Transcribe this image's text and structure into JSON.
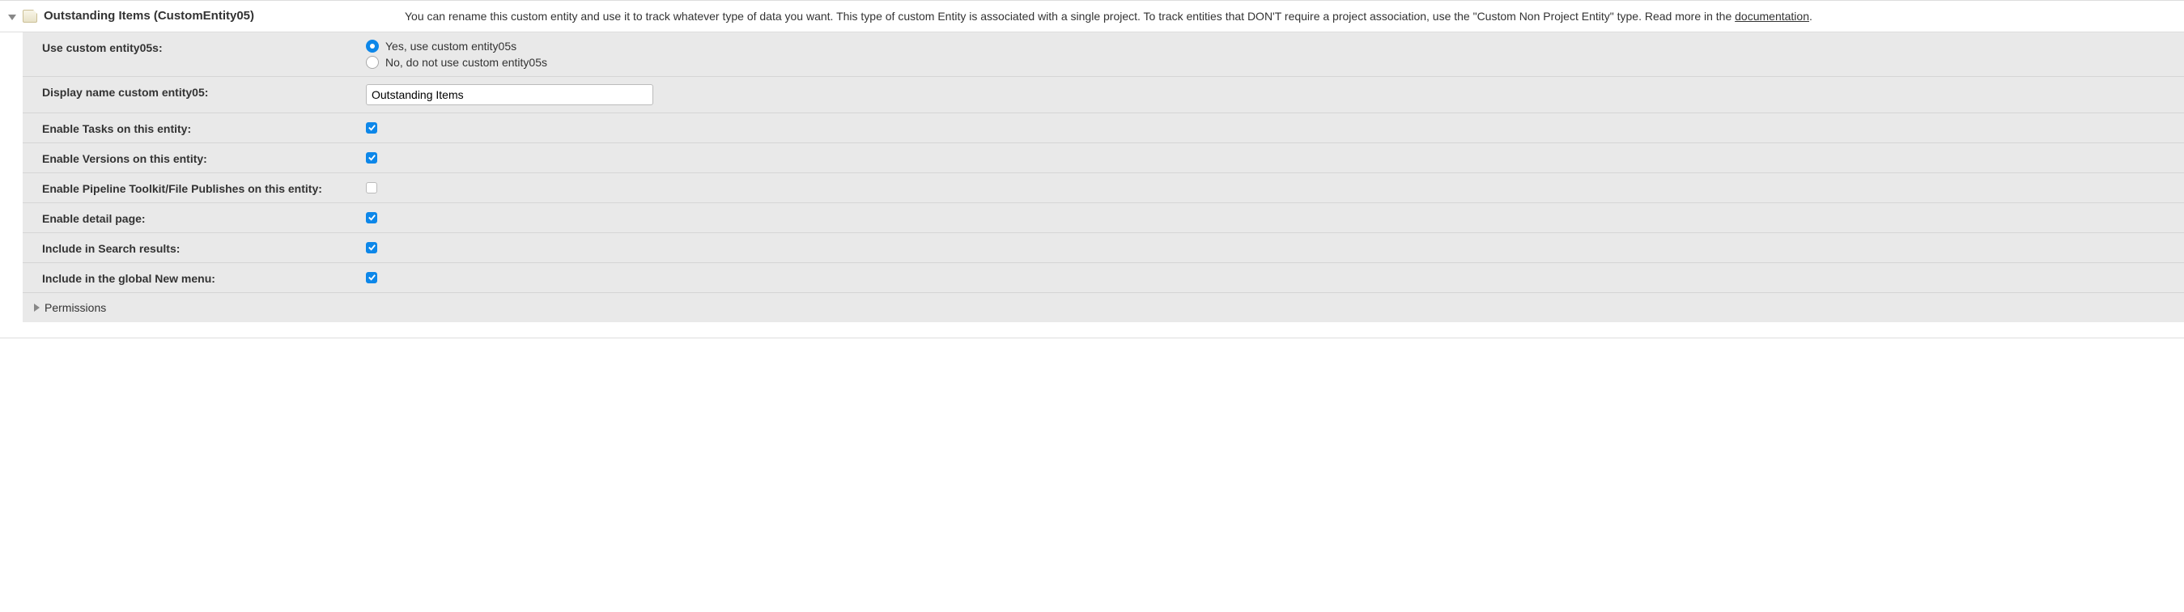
{
  "header": {
    "title": "Outstanding Items (CustomEntity05)",
    "description_part1": "You can rename this custom entity and use it to track whatever type of data you want. This type of custom Entity is associated with a single project. To track entities that DON'T require a project association, use the \"Custom Non Project Entity\" type. Read more in the ",
    "documentation_link": "documentation",
    "description_part2": "."
  },
  "settings": {
    "use_custom": {
      "label": "Use custom entity05s:",
      "yes": "Yes, use custom entity05s",
      "no": "No, do not use custom entity05s",
      "value": "yes"
    },
    "display_name": {
      "label": "Display name custom entity05:",
      "value": "Outstanding Items"
    },
    "enable_tasks": {
      "label": "Enable Tasks on this entity:",
      "checked": true
    },
    "enable_versions": {
      "label": "Enable Versions on this entity:",
      "checked": true
    },
    "enable_pipeline": {
      "label": "Enable Pipeline Toolkit/File Publishes on this entity:",
      "checked": false
    },
    "enable_detail": {
      "label": "Enable detail page:",
      "checked": true
    },
    "include_search": {
      "label": "Include in Search results:",
      "checked": true
    },
    "include_new_menu": {
      "label": "Include in the global New menu:",
      "checked": true
    }
  },
  "permissions": {
    "label": "Permissions"
  }
}
